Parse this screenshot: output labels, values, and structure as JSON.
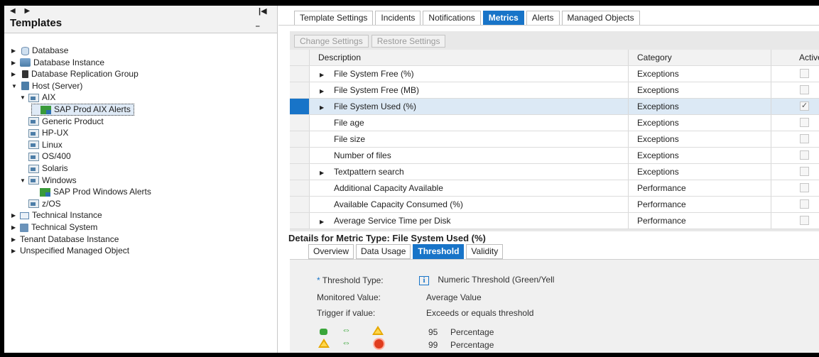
{
  "left": {
    "title": "Templates",
    "tree": [
      {
        "label": "Database",
        "icon": "database-icon",
        "expand": "collapsed"
      },
      {
        "label": "Database Instance",
        "icon": "database-instance-icon",
        "expand": "collapsed"
      },
      {
        "label": "Database Replication Group",
        "icon": "replication-group-icon",
        "expand": "collapsed"
      },
      {
        "label": "Host (Server)",
        "icon": "host-server-icon",
        "expand": "expanded"
      },
      {
        "label": "AIX",
        "icon": "template-icon",
        "expand": "expanded"
      },
      {
        "label": "SAP Prod AIX Alerts",
        "icon": "alert-template-icon",
        "expand": "none",
        "selected": true
      },
      {
        "label": "Generic Product",
        "icon": "template-icon",
        "expand": "none"
      },
      {
        "label": "HP-UX",
        "icon": "template-icon",
        "expand": "none"
      },
      {
        "label": "Linux",
        "icon": "template-icon",
        "expand": "none"
      },
      {
        "label": "OS/400",
        "icon": "template-icon",
        "expand": "none"
      },
      {
        "label": "Solaris",
        "icon": "template-icon",
        "expand": "none"
      },
      {
        "label": "Windows",
        "icon": "template-icon",
        "expand": "expanded"
      },
      {
        "label": "SAP Prod Windows Alerts",
        "icon": "alert-template-icon",
        "expand": "none"
      },
      {
        "label": "z/OS",
        "icon": "template-icon",
        "expand": "none"
      },
      {
        "label": "Technical Instance",
        "icon": "technical-instance-icon",
        "expand": "collapsed"
      },
      {
        "label": "Technical System",
        "icon": "technical-system-icon",
        "expand": "collapsed"
      },
      {
        "label": "Tenant Database Instance",
        "icon": "",
        "expand": "collapsed"
      },
      {
        "label": "Unspecified Managed Object",
        "icon": "",
        "expand": "collapsed"
      }
    ]
  },
  "tabs": [
    "Template Settings",
    "Incidents",
    "Notifications",
    "Metrics",
    "Alerts",
    "Managed Objects"
  ],
  "active_tab": "Metrics",
  "toolbar": {
    "change_settings": "Change Settings",
    "restore_settings": "Restore Settings"
  },
  "grid": {
    "headers": {
      "description": "Description",
      "category": "Category",
      "active": "Active"
    },
    "rows": [
      {
        "description": "File System Free (%)",
        "category": "Exceptions",
        "expandable": true,
        "active": false
      },
      {
        "description": "File System Free (MB)",
        "category": "Exceptions",
        "expandable": true,
        "active": false
      },
      {
        "description": "File System Used (%)",
        "category": "Exceptions",
        "expandable": true,
        "active": true,
        "selected": true
      },
      {
        "description": "File age",
        "category": "Exceptions",
        "expandable": false,
        "active": false
      },
      {
        "description": "File size",
        "category": "Exceptions",
        "expandable": false,
        "active": false
      },
      {
        "description": "Number of files",
        "category": "Exceptions",
        "expandable": false,
        "active": false
      },
      {
        "description": "Textpattern search",
        "category": "Exceptions",
        "expandable": true,
        "active": false
      },
      {
        "description": "Additional Capacity Available",
        "category": "Performance",
        "expandable": false,
        "active": false
      },
      {
        "description": "Available Capacity Consumed (%)",
        "category": "Performance",
        "expandable": false,
        "active": false
      },
      {
        "description": "Average Service Time per Disk",
        "category": "Performance",
        "expandable": true,
        "active": false
      }
    ]
  },
  "details": {
    "title": "Details for Metric Type: File System Used (%)",
    "tabs": [
      "Overview",
      "Data Usage",
      "Threshold",
      "Validity"
    ],
    "active_tab": "Threshold",
    "threshold_type_label": "Threshold Type:",
    "threshold_type_required_marker": "*",
    "threshold_type_value": "Numeric Threshold (Green/Yell",
    "monitored_value_label": "Monitored Value:",
    "monitored_value": "Average Value",
    "trigger_label": "Trigger if value:",
    "trigger_value": "Exceeds or equals threshold",
    "thresholds": [
      {
        "value": "95",
        "unit": "Percentage",
        "from": "green",
        "to": "yellow"
      },
      {
        "value": "99",
        "unit": "Percentage",
        "from": "yellow",
        "to": "red"
      }
    ]
  }
}
